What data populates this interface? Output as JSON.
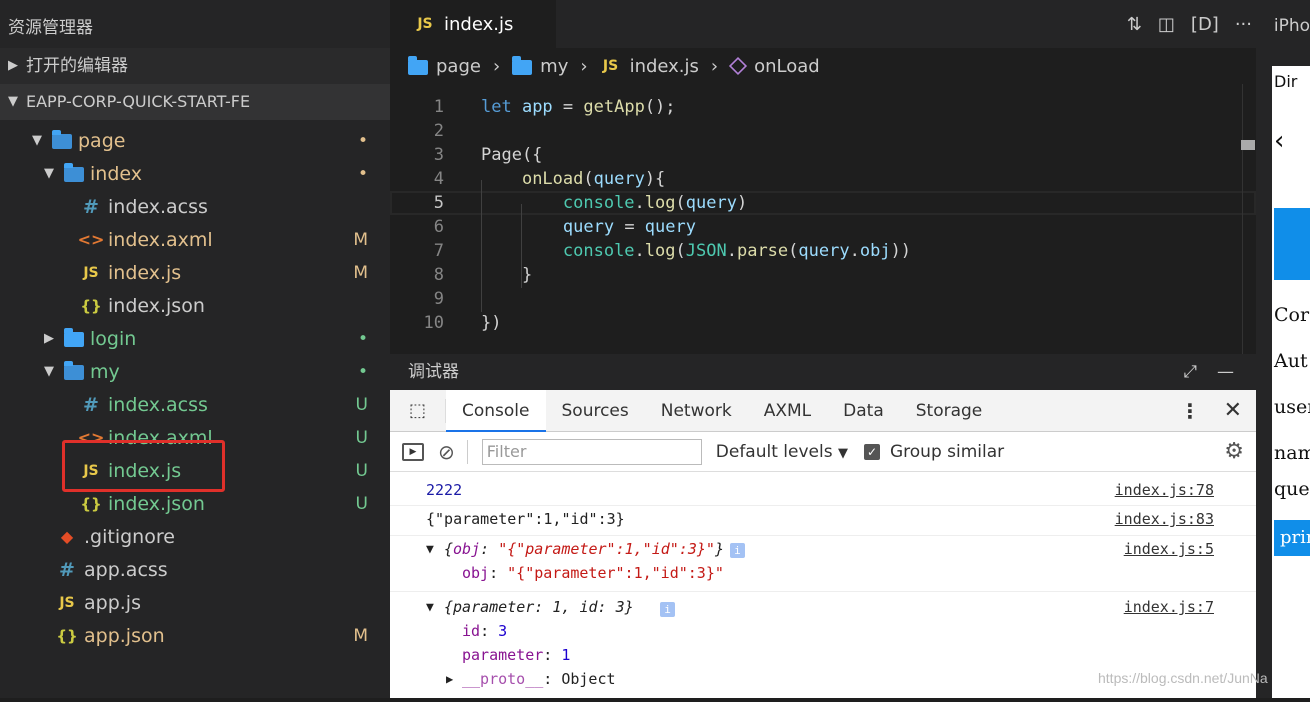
{
  "sidebar": {
    "title": "资源管理器",
    "open_editors": "打开的编辑器",
    "project": "EAPP-CORP-QUICK-START-FE",
    "tree": [
      {
        "label": "page",
        "badge": "•",
        "type": "folder-open",
        "color": "yellow"
      },
      {
        "label": "index",
        "badge": "•",
        "type": "folder-open",
        "color": "yellow"
      },
      {
        "label": "index.acss",
        "badge": "",
        "type": "acss",
        "color": "normal"
      },
      {
        "label": "index.axml",
        "badge": "M",
        "type": "axml",
        "color": "yellow"
      },
      {
        "label": "index.js",
        "badge": "M",
        "type": "js",
        "color": "yellow"
      },
      {
        "label": "index.json",
        "badge": "",
        "type": "json",
        "color": "normal"
      },
      {
        "label": "login",
        "badge": "•",
        "type": "folder",
        "color": "green"
      },
      {
        "label": "my",
        "badge": "•",
        "type": "folder-open",
        "color": "green"
      },
      {
        "label": "index.acss",
        "badge": "U",
        "type": "acss",
        "color": "green"
      },
      {
        "label": "index.axml",
        "badge": "U",
        "type": "axml",
        "color": "green"
      },
      {
        "label": "index.js",
        "badge": "U",
        "type": "js",
        "color": "green"
      },
      {
        "label": "index.json",
        "badge": "U",
        "type": "json",
        "color": "green"
      },
      {
        "label": ".gitignore",
        "badge": "",
        "type": "git",
        "color": "normal"
      },
      {
        "label": "app.acss",
        "badge": "",
        "type": "acss",
        "color": "normal"
      },
      {
        "label": "app.js",
        "badge": "",
        "type": "js",
        "color": "normal"
      },
      {
        "label": "app.json",
        "badge": "M",
        "type": "json",
        "color": "yellow"
      }
    ]
  },
  "tab": {
    "icon": "JS",
    "label": "index.js"
  },
  "topbar_right": "iPho",
  "breadcrumb": [
    "page",
    "my",
    "index.js",
    "onLoad"
  ],
  "editor": {
    "line_numbers": [
      "1",
      "2",
      "3",
      "4",
      "5",
      "6",
      "7",
      "8",
      "9",
      "10"
    ]
  },
  "debugger": {
    "title": "调试器"
  },
  "devtools": {
    "tabs": [
      "Console",
      "Sources",
      "Network",
      "AXML",
      "Data",
      "Storage"
    ],
    "filter_placeholder": "Filter",
    "levels": "Default levels",
    "group_similar": "Group similar",
    "console": [
      {
        "text": "2222",
        "source": "index.js:78"
      },
      {
        "text": "{\"parameter\":1,\"id\":3}",
        "source": "index.js:83"
      },
      {
        "summary_key": "obj",
        "summary_val": "\"{\"parameter\":1,\"id\":3}\"",
        "child_key": "obj",
        "child_val": "\"{\"parameter\":1,\"id\":3}\"",
        "source": "index.js:5"
      },
      {
        "summary": "{parameter: 1, id: 3}",
        "children": [
          {
            "k": "id",
            "v": "3"
          },
          {
            "k": "parameter",
            "v": "1"
          },
          {
            "k": "__proto__",
            "v": "Object"
          }
        ],
        "source": "index.js:7"
      }
    ]
  },
  "preview": {
    "lines": [
      "Dir",
      "Cor",
      "Aut",
      "user",
      "nam",
      "quer"
    ],
    "button": "prin"
  },
  "watermark": "https://blog.csdn.net/JunNa"
}
